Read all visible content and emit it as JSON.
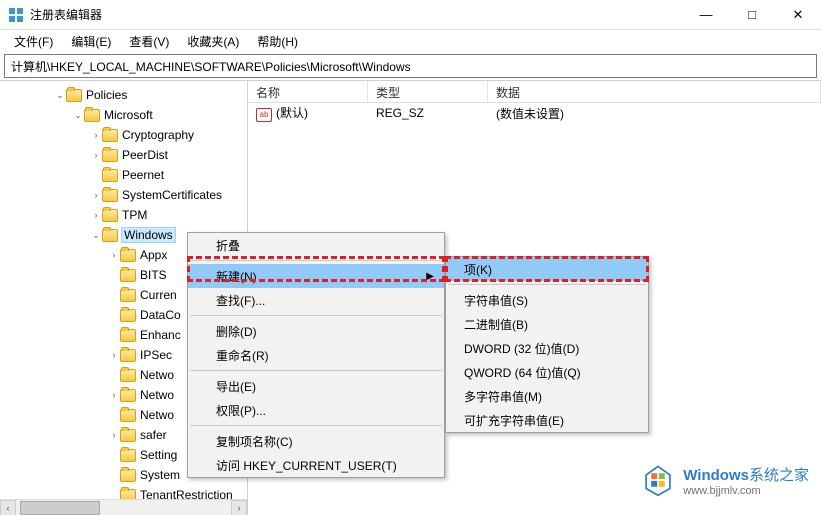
{
  "window": {
    "title": "注册表编辑器",
    "controls": {
      "min": "—",
      "max": "□",
      "close": "✕"
    }
  },
  "menubar": {
    "file": "文件(F)",
    "edit": "编辑(E)",
    "view": "查看(V)",
    "fav": "收藏夹(A)",
    "help": "帮助(H)"
  },
  "path": "计算机\\HKEY_LOCAL_MACHINE\\SOFTWARE\\Policies\\Microsoft\\Windows",
  "tree": {
    "policies": "Policies",
    "microsoft": "Microsoft",
    "items": [
      "Cryptography",
      "PeerDist",
      "Peernet",
      "SystemCertificates",
      "TPM"
    ],
    "windows": "Windows",
    "win_items": [
      "Appx",
      "BITS",
      "Curren",
      "DataCo",
      "Enhanc",
      "IPSec",
      "Netwo",
      "Netwo",
      "Netwo",
      "safer",
      "Setting",
      "System",
      "TenantRestriction"
    ]
  },
  "list": {
    "headers": {
      "name": "名称",
      "type": "类型",
      "data": "数据"
    },
    "rows": [
      {
        "icon": "ab",
        "name": "(默认)",
        "type": "REG_SZ",
        "data": "(数值未设置)"
      }
    ]
  },
  "context_menu": {
    "collapse": "折叠",
    "new": "新建(N)",
    "find": "查找(F)...",
    "delete": "删除(D)",
    "rename": "重命名(R)",
    "export": "导出(E)",
    "perm": "权限(P)...",
    "copy_key": "复制项名称(C)",
    "goto": "访问 HKEY_CURRENT_USER(T)"
  },
  "submenu": {
    "key": "项(K)",
    "string": "字符串值(S)",
    "binary": "二进制值(B)",
    "dword": "DWORD (32 位)值(D)",
    "qword": "QWORD (64 位)值(Q)",
    "multi": "多字符串值(M)",
    "expand": "可扩充字符串值(E)"
  },
  "watermark": {
    "brand_a": "Windows",
    "brand_b": "系统之家",
    "url": "www.bjjmlv.com"
  }
}
